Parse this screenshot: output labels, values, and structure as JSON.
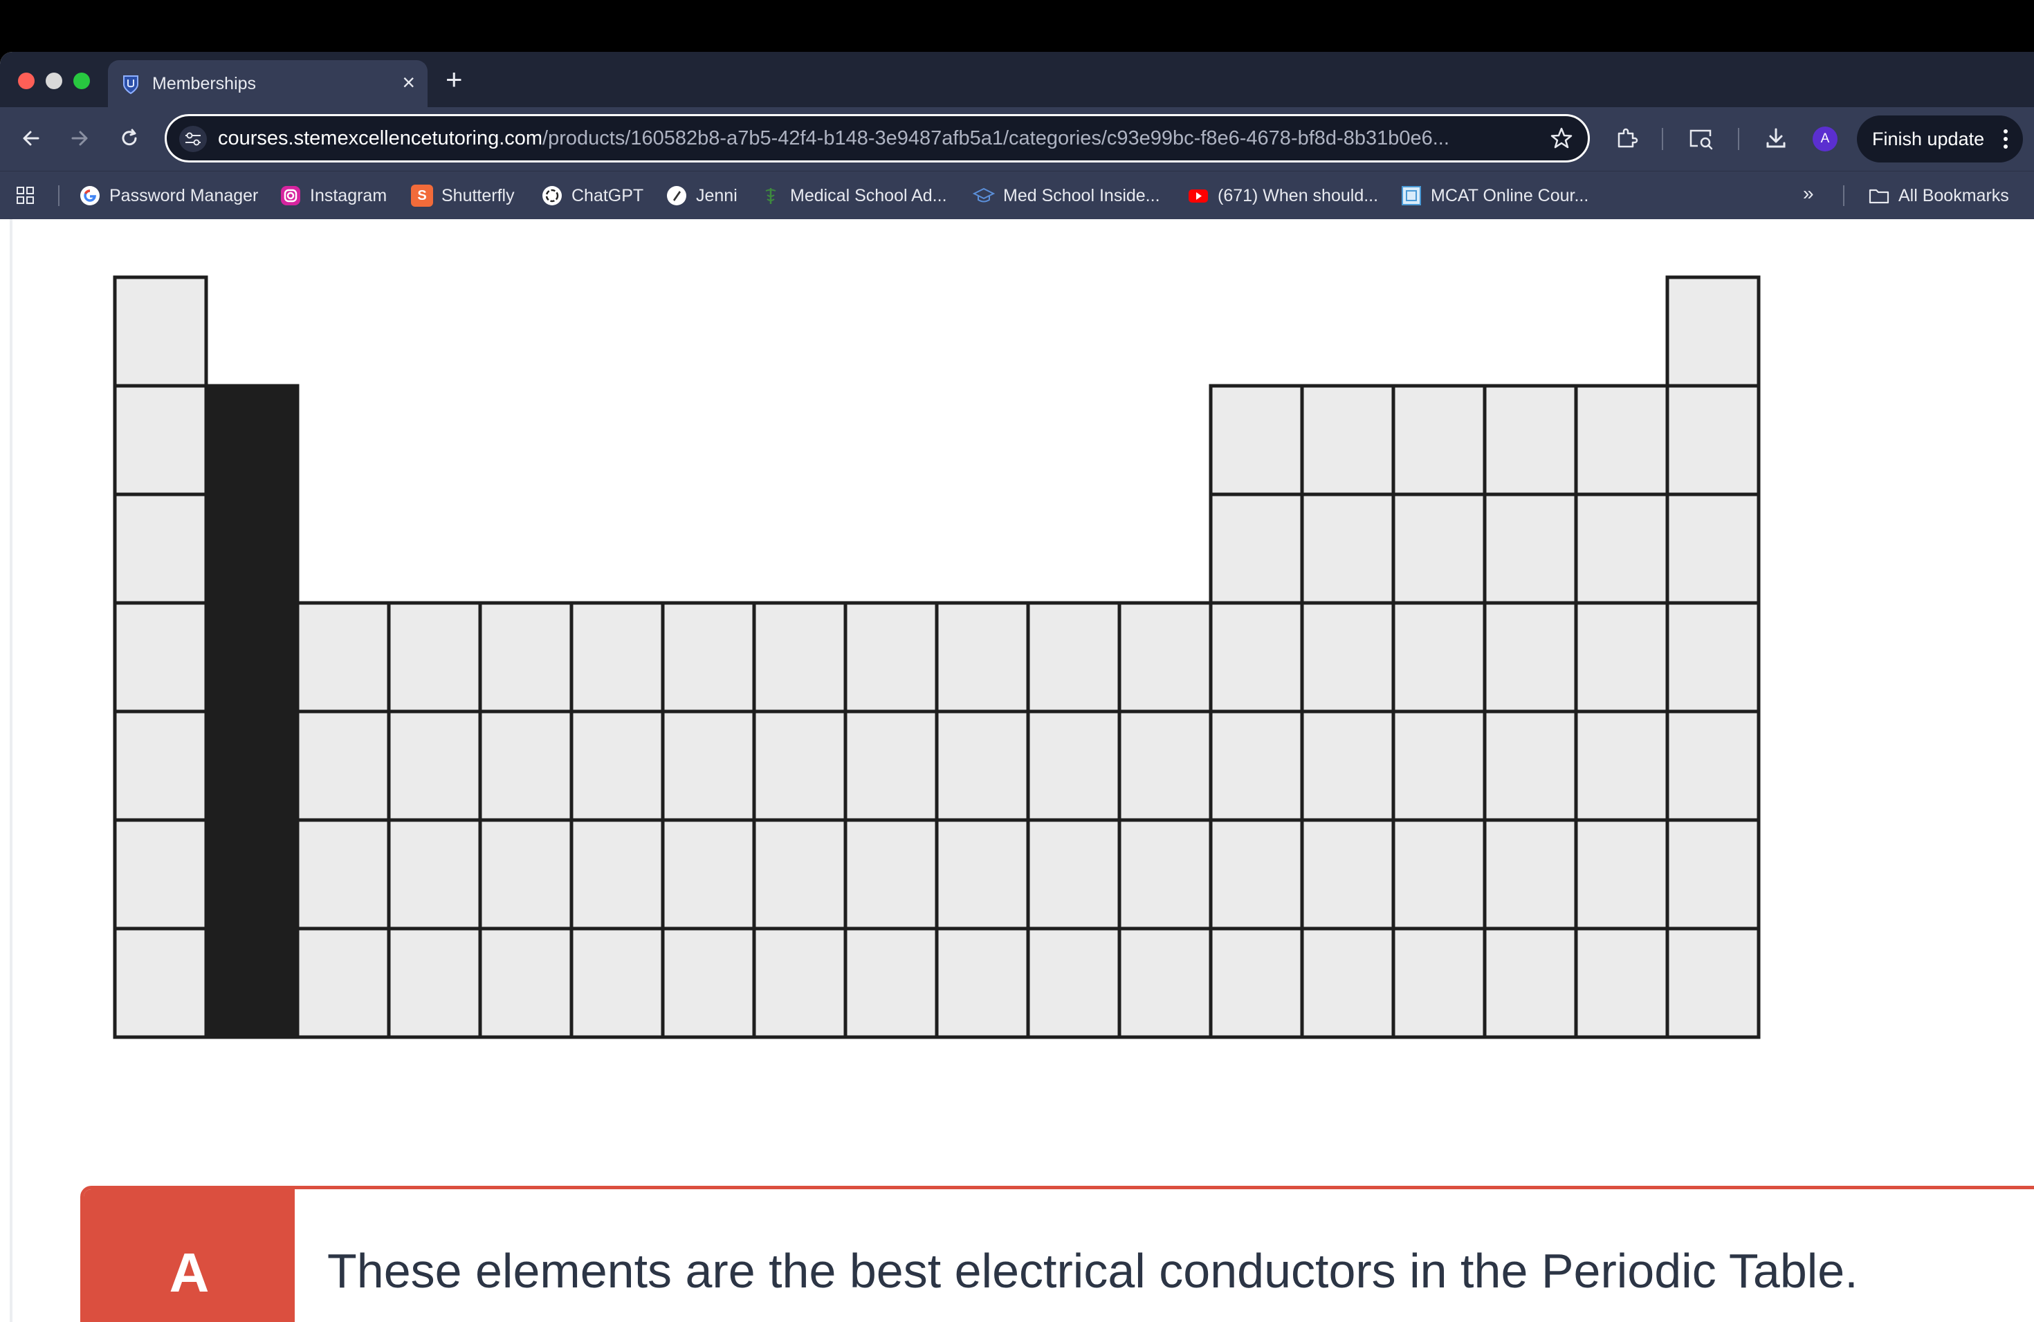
{
  "browser": {
    "tab": {
      "title": "Memberships"
    },
    "address_bar": {
      "domain": "courses.stemexcellencetutoring.com",
      "path": "/products/160582b8-a7b5-42f4-b148-3e9487afb5a1/categories/c93e99bc-f8e6-4678-bf8d-8b31b0e6..."
    },
    "profile_initial": "A",
    "finish_update_label": "Finish update",
    "bookmarks": [
      {
        "label": "Password Manager",
        "icon": "google-icon"
      },
      {
        "label": "Instagram",
        "icon": "instagram-icon"
      },
      {
        "label": "Shutterfly",
        "icon": "shutterfly-icon",
        "glyph": "S"
      },
      {
        "label": "ChatGPT",
        "icon": "chatgpt-icon"
      },
      {
        "label": "Jenni",
        "icon": "jenni-icon"
      },
      {
        "label": "Medical School Ad...",
        "icon": "caduceus-icon"
      },
      {
        "label": "Med School Inside...",
        "icon": "graduation-cap-icon"
      },
      {
        "label": "(671) When should...",
        "icon": "youtube-icon"
      },
      {
        "label": "MCAT Online Cour...",
        "icon": "mcat-icon"
      }
    ],
    "all_bookmarks_label": "All Bookmarks",
    "colors": {
      "tabstrip": "#1f2536",
      "toolbar": "#353d56",
      "omnibox": "#141927"
    }
  },
  "periodic_table": {
    "highlighted_group": 2,
    "cell_fill": "#ebebeb",
    "highlight_fill": "#1e1e1e"
  },
  "answer": {
    "letter": "A",
    "text": "These elements are the best electrical conductors in the Periodic Table.",
    "accent_color": "#db4f3f"
  }
}
